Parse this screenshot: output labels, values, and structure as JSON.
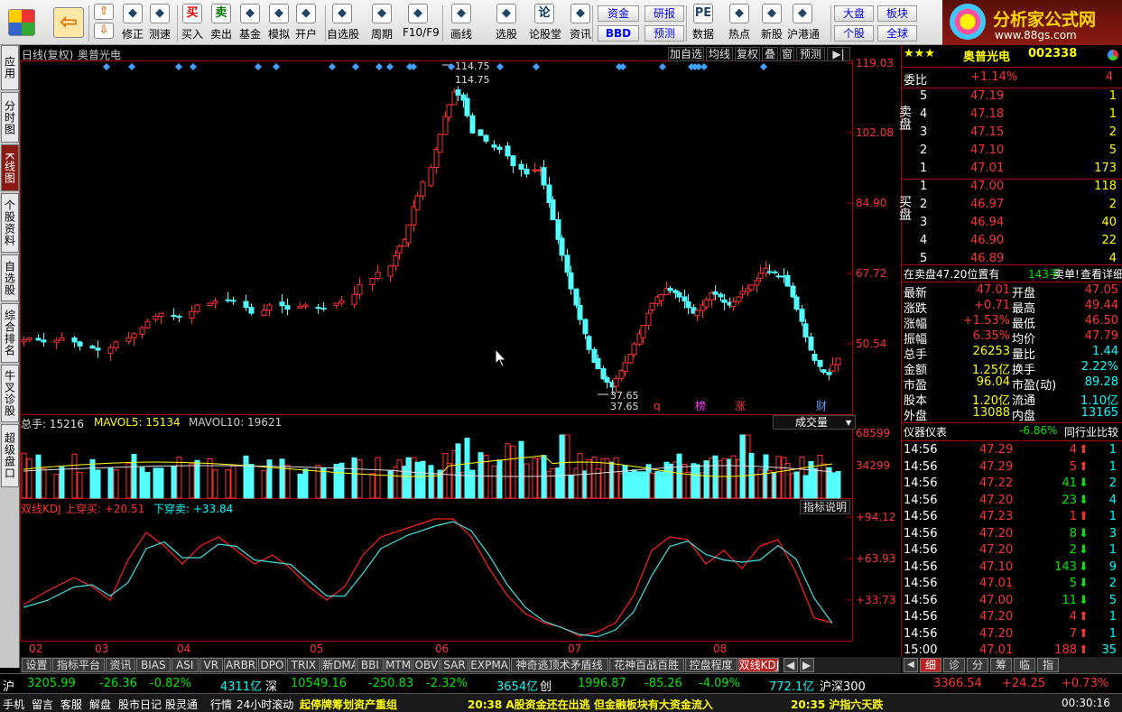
{
  "toolbar": {
    "buttons": [
      {
        "label": "修正",
        "icon": "gear-icon"
      },
      {
        "label": "测速",
        "icon": "clock-icon"
      },
      {
        "label": "买入",
        "icon": "buy-icon",
        "glyph": "买"
      },
      {
        "label": "卖出",
        "icon": "sell-icon",
        "glyph": "卖"
      },
      {
        "label": "基金",
        "icon": "fund-icon"
      },
      {
        "label": "模拟",
        "icon": "hammer-icon"
      },
      {
        "label": "开户",
        "icon": "lock-icon"
      },
      {
        "label": "自选股",
        "icon": "star-icon"
      },
      {
        "label": "周期",
        "icon": "cycle-icon"
      },
      {
        "label": "F10/F9",
        "icon": "doc-icon"
      },
      {
        "label": "画线",
        "icon": "pen-icon"
      },
      {
        "label": "选股",
        "icon": "screen-icon"
      },
      {
        "label": "论股堂",
        "icon": "forum-icon",
        "glyph": "论"
      },
      {
        "label": "资讯",
        "icon": "news-icon"
      },
      {
        "label": "数据",
        "icon": "pe-icon",
        "glyph": "PE"
      },
      {
        "label": "热点",
        "icon": "fire-icon"
      },
      {
        "label": "新股",
        "icon": "ipo-icon"
      },
      {
        "label": "沪港通",
        "icon": "hk-icon"
      }
    ],
    "small_buttons": [
      "资金",
      "研报",
      "BBD",
      "预测",
      "大盘",
      "板块",
      "个股",
      "全球"
    ]
  },
  "logo": {
    "title": "分析家公式网",
    "url": "www.88gs.com"
  },
  "left_tabs": [
    "应用",
    "分时图",
    "K线图",
    "个股资料",
    "自选股",
    "综合排名",
    "牛叉诊股",
    "超级盘口"
  ],
  "chart": {
    "period_label": "日线(复权)",
    "stock_name": "奥普光电",
    "top_buttons": [
      "加自选",
      "均线",
      "复权",
      "叠",
      "窗",
      "预测"
    ],
    "price_axis": [
      "119.03",
      "102.08",
      "84.90",
      "67.72",
      "50.54"
    ],
    "high_label": "114.75",
    "high_label2": "114.75",
    "low_label": "37.65",
    "low_label2": "37.65",
    "markers": [
      {
        "text": "q",
        "color": "#ff3030"
      },
      {
        "text": "榜",
        "color": "#ff40ff"
      },
      {
        "text": "涨",
        "color": "#ff3030"
      },
      {
        "text": "财",
        "color": "#5aa0ff"
      }
    ],
    "volume_header": {
      "total": "总手: 15216",
      "mavol5": "MAVOL5: 15134",
      "mavol10": "MAVOL10: 19621",
      "select": "成交量"
    },
    "volume_axis": [
      "68599",
      "34299"
    ],
    "kdj_header": {
      "name": "双线KDJ",
      "up": "上穿买: +20.51",
      "down": "下穿卖: +33.84",
      "help": "指标说明"
    },
    "kdj_axis": [
      "+94.12",
      "+63.93",
      "+33.73"
    ],
    "x_labels": [
      "02",
      "03",
      "04",
      "05",
      "06",
      "07",
      "08"
    ]
  },
  "chart_data": {
    "type": "candlestick",
    "x_labels": [
      "02",
      "03",
      "04",
      "05",
      "06",
      "07",
      "08"
    ],
    "price_ticks": [
      119.03,
      102.08,
      84.9,
      67.72,
      50.54
    ],
    "high": 114.75,
    "low": 37.65,
    "volume_ticks": [
      68599,
      34299
    ],
    "kdj_ticks": [
      94.12,
      63.93,
      33.73
    ]
  },
  "quote": {
    "stars": "★★★",
    "name": "奥普光电",
    "code": "002338",
    "weibi_label": "委比",
    "weibi_value": "+1.14%",
    "weibi_count": "4",
    "sell_label": "卖盘",
    "buy_label": "买盘",
    "sell": [
      {
        "lvl": "5",
        "price": "47.19",
        "vol": "1"
      },
      {
        "lvl": "4",
        "price": "47.18",
        "vol": "1"
      },
      {
        "lvl": "3",
        "price": "47.15",
        "vol": "2"
      },
      {
        "lvl": "2",
        "price": "47.10",
        "vol": "5"
      },
      {
        "lvl": "1",
        "price": "47.01",
        "vol": "173"
      }
    ],
    "buy": [
      {
        "lvl": "1",
        "price": "47.00",
        "vol": "118"
      },
      {
        "lvl": "2",
        "price": "46.97",
        "vol": "2"
      },
      {
        "lvl": "3",
        "price": "46.94",
        "vol": "40"
      },
      {
        "lvl": "4",
        "price": "46.90",
        "vol": "22"
      },
      {
        "lvl": "5",
        "price": "46.89",
        "vol": "4"
      }
    ],
    "notice": {
      "a": "在卖盘47.20位置有",
      "b": "143手",
      "c": "卖单!",
      "d": "查看详细"
    },
    "stats": [
      {
        "l1": "最新",
        "v1": "47.01",
        "l2": "开盘",
        "v2": "47.05"
      },
      {
        "l1": "涨跌",
        "v1": "+0.71",
        "l2": "最高",
        "v2": "49.44"
      },
      {
        "l1": "涨幅",
        "v1": "+1.53%",
        "l2": "最低",
        "v2": "46.50"
      },
      {
        "l1": "振幅",
        "v1": "6.35%",
        "l2": "均价",
        "v2": "47.79"
      },
      {
        "l1": "总手",
        "v1": "26253",
        "l2": "量比",
        "v2": "1.44"
      },
      {
        "l1": "金额",
        "v1": "1.25亿",
        "l2": "换手",
        "v2": "2.22%"
      },
      {
        "l1": "市盈",
        "v1": "96.04",
        "l2": "市盈(动)",
        "v2": "89.28"
      },
      {
        "l1": "股本",
        "v1": "1.20亿",
        "l2": "流通",
        "v2": "1.10亿"
      },
      {
        "l1": "外盘",
        "v1": "13088",
        "l2": "内盘",
        "v2": "13165"
      }
    ],
    "meter": {
      "label": "仪器仪表",
      "value": "-6.86%",
      "compare": "同行业比较"
    },
    "ticks": [
      {
        "t": "14:56",
        "p": "47.29",
        "v": "4",
        "d": "up",
        "n": "1"
      },
      {
        "t": "14:56",
        "p": "47.29",
        "v": "5",
        "d": "up",
        "n": "1"
      },
      {
        "t": "14:56",
        "p": "47.22",
        "v": "41",
        "d": "down",
        "n": "2"
      },
      {
        "t": "14:56",
        "p": "47.20",
        "v": "23",
        "d": "down",
        "n": "4"
      },
      {
        "t": "14:56",
        "p": "47.23",
        "v": "1",
        "d": "up",
        "n": "1"
      },
      {
        "t": "14:56",
        "p": "47.20",
        "v": "8",
        "d": "down",
        "n": "3"
      },
      {
        "t": "14:56",
        "p": "47.20",
        "v": "2",
        "d": "down",
        "n": "1"
      },
      {
        "t": "14:56",
        "p": "47.10",
        "v": "143",
        "d": "down",
        "n": "9"
      },
      {
        "t": "14:56",
        "p": "47.01",
        "v": "5",
        "d": "down",
        "n": "2"
      },
      {
        "t": "14:56",
        "p": "47.00",
        "v": "11",
        "d": "down",
        "n": "5"
      },
      {
        "t": "14:56",
        "p": "47.20",
        "v": "4",
        "d": "up",
        "n": "1"
      },
      {
        "t": "14:56",
        "p": "47.20",
        "v": "7",
        "d": "up",
        "n": "1"
      },
      {
        "t": "15:00",
        "p": "47.01",
        "v": "188",
        "d": "up",
        "n": "35"
      }
    ],
    "bottom_tabs": [
      "细",
      "诊",
      "分",
      "筹",
      "临",
      "指"
    ]
  },
  "bottom_tabs": [
    "设置",
    "指标平台",
    "资讯",
    "BIAS",
    "ASI",
    "VR",
    "ARBR",
    "DPO",
    "TRIX",
    "新DMA",
    "BBI",
    "MTM",
    "OBV",
    "SAR",
    "EXPMA",
    "神奇逃顶术矛盾线",
    "花神百战百胜",
    "控盘程度",
    "双线KDJ"
  ],
  "status": {
    "sh_label": "沪",
    "sh_index": "3205.99",
    "sh_chg": "-26.36",
    "sh_pct": "-0.82%",
    "sh_amt": "4311亿",
    "sz_label": "深",
    "sz_index": "10549.16",
    "sz_chg": "-250.83",
    "sz_pct": "-2.32%",
    "sz_amt": "3654亿",
    "cy_label": "创",
    "cy_index": "1996.87",
    "cy_chg": "-85.26",
    "cy_pct": "-4.09%",
    "cy_amt": "772.1亿",
    "hs_label": "沪深300",
    "hs_index": "3366.54",
    "hs_chg": "+24.25",
    "hs_pct": "+0.73%"
  },
  "news": {
    "items": [
      "手机",
      "留言",
      "客服",
      "解盘",
      "股市日记",
      "股灵通",
      "行情",
      "24小时滚动"
    ],
    "headline1": "起停牌筹划资产重组",
    "headline2": "20:38 A股资金还在出逃  但金融板块有大资金流入",
    "headline3": "20:35 沪指六天跌",
    "time": "00:30:16"
  }
}
